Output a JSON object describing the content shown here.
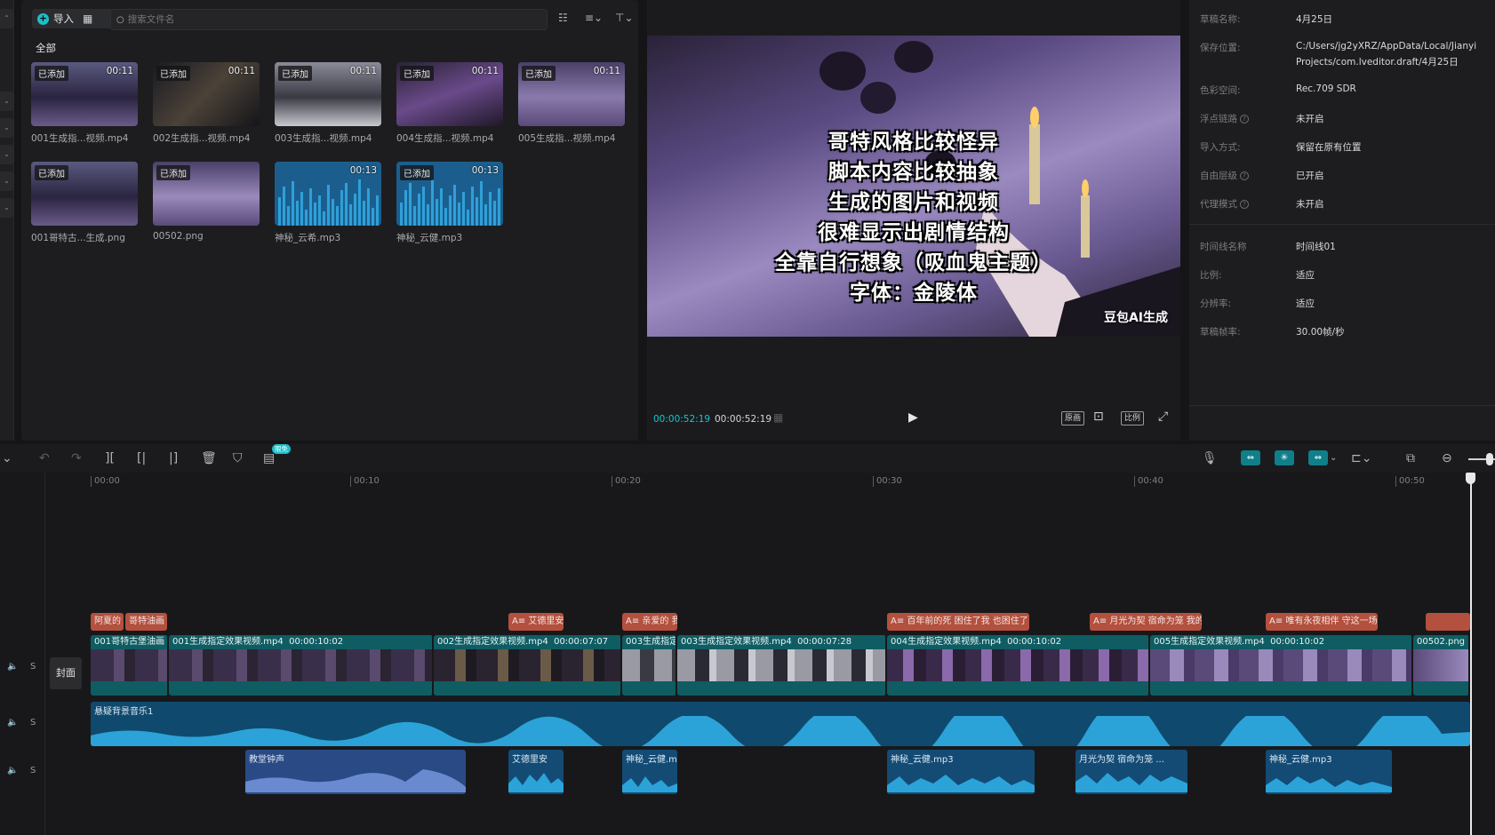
{
  "media": {
    "import_label": "导入",
    "search_placeholder": "搜索文件名",
    "tab_all": "全部",
    "items": [
      {
        "badge": "已添加",
        "duration": "00:11",
        "name": "001生成指...视频.mp4"
      },
      {
        "badge": "已添加",
        "duration": "00:11",
        "name": "002生成指...视频.mp4"
      },
      {
        "badge": "已添加",
        "duration": "00:11",
        "name": "003生成指...视频.mp4"
      },
      {
        "badge": "已添加",
        "duration": "00:11",
        "name": "004生成指...视频.mp4"
      },
      {
        "badge": "已添加",
        "duration": "00:11",
        "name": "005生成指...视频.mp4"
      },
      {
        "badge": "已添加",
        "duration": "",
        "name": "001哥特古...生成.png"
      },
      {
        "badge": "已添加",
        "duration": "",
        "name": "00502.png"
      },
      {
        "badge": "",
        "duration": "00:13",
        "name": "神秘_云希.mp3"
      },
      {
        "badge": "已添加",
        "duration": "00:13",
        "name": "神秘_云健.mp3"
      }
    ]
  },
  "preview": {
    "subtitles": [
      "哥特风格比较怪异",
      "脚本内容比较抽象",
      "生成的图片和视频",
      "很难显示出剧情结构",
      "全靠自行想象（吸血鬼主题）",
      "字体：金陵体"
    ],
    "watermark": "豆包AI生成",
    "current_time": "00:00:52:19",
    "total_time": "00:00:52:19",
    "btn_original": "原画",
    "btn_ratio": "比例"
  },
  "properties": {
    "rows": [
      {
        "label": "草稿名称:",
        "value": "4月25日"
      },
      {
        "label": "保存位置:",
        "value": "C:/Users/jg2yXRZ/AppData/Local/Jianyi",
        "value2": "Projects/com.lveditor.draft/4月25日"
      },
      {
        "label": "色彩空间:",
        "value": "Rec.709 SDR"
      },
      {
        "label": "浮点链路",
        "value": "未开启"
      },
      {
        "label": "导入方式:",
        "value": "保留在原有位置"
      },
      {
        "label": "自由层级",
        "value": "已开启"
      },
      {
        "label": "代理模式",
        "value": "未开启"
      },
      {
        "label": "时间线名称",
        "value": "时间线01"
      },
      {
        "label": "比例:",
        "value": "适应"
      },
      {
        "label": "分辨率:",
        "value": "适应"
      },
      {
        "label": "草稿帧率:",
        "value": "30.00帧/秒"
      }
    ]
  },
  "toolbar": {
    "free_badge": "限免"
  },
  "timeline": {
    "ruler": [
      "00:00",
      "00:10",
      "00:20",
      "00:30",
      "00:40",
      "00:50"
    ],
    "cover_label": "封面",
    "track_mute": "S",
    "text_clips": [
      "阿夏的",
      "哥特油画",
      "A≡ 艾德里安",
      "A≡ 亲爱的 我",
      "A≡ 百年前的死 困住了我 也困住了",
      "A≡ 月光为契 宿命为笼 我的",
      "A≡ 唯有永夜相伴 守这一场",
      ""
    ],
    "video_clips": [
      {
        "name": "001哥特古堡油画",
        "dur": ""
      },
      {
        "name": "001生成指定效果视频.mp4",
        "dur": "00:00:10:02"
      },
      {
        "name": "002生成指定效果视频.mp4",
        "dur": "00:00:07:07"
      },
      {
        "name": "003生成指定",
        "dur": ""
      },
      {
        "name": "003生成指定效果视频.mp4",
        "dur": "00:00:07:28"
      },
      {
        "name": "004生成指定效果视频.mp4",
        "dur": "00:00:10:02"
      },
      {
        "name": "005生成指定效果视频.mp4",
        "dur": "00:00:10:02"
      },
      {
        "name": "00502.png",
        "dur": ""
      }
    ],
    "bgm_label": "悬疑背景音乐1",
    "audio_clips": [
      "教堂钟声",
      "艾德里安",
      "神秘_云健.mp",
      "神秘_云健.mp3",
      "月光为契 宿命为笼 ...",
      "神秘_云健.mp3"
    ]
  }
}
